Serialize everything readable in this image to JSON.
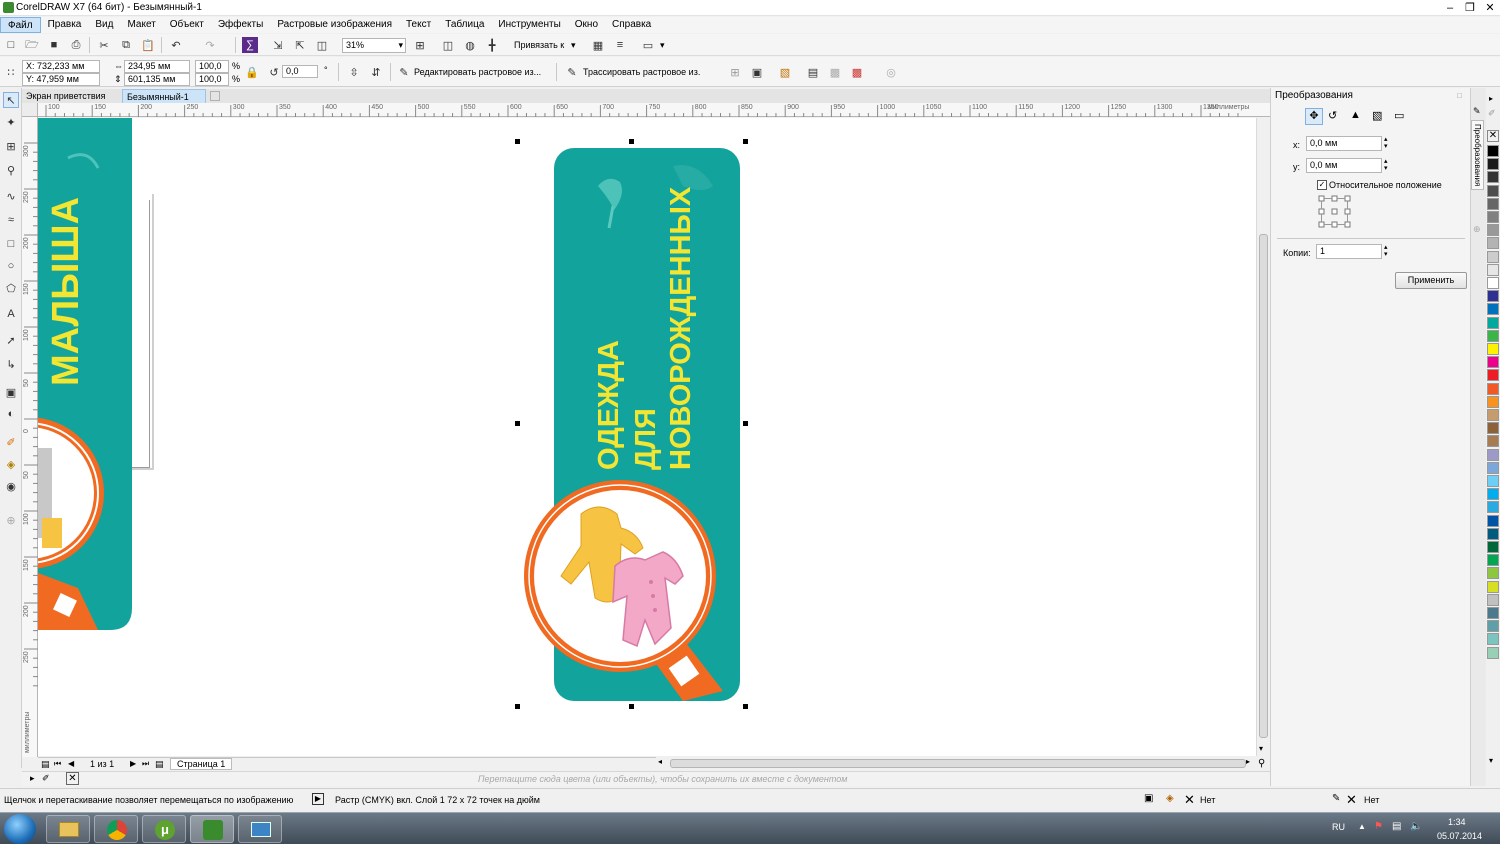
{
  "window": {
    "title": "CorelDRAW X7 (64 бит) - Безымянный-1"
  },
  "menu": [
    "Файл",
    "Правка",
    "Вид",
    "Макет",
    "Объект",
    "Эффекты",
    "Растровые изображения",
    "Текст",
    "Таблица",
    "Инструменты",
    "Окно",
    "Справка"
  ],
  "toolbar1": {
    "zoom": "31%",
    "snap_label": "Привязать к"
  },
  "propbar": {
    "x": "X: 732,233 мм",
    "y": "Y: 47,959 мм",
    "width": "234,95 мм",
    "height": "601,135 мм",
    "scale_w": "100,0",
    "scale_h": "100,0",
    "percent": "%",
    "angle": "0,0",
    "degree": "°",
    "edit_bitmap": "Редактировать растровое из...",
    "trace_bitmap": "Трассировать растровое из."
  },
  "doc_tabs": [
    "Экран приветствия",
    "Безымянный-1"
  ],
  "ruler_h": [
    "100",
    "150",
    "200",
    "250",
    "300",
    "350",
    "400",
    "450",
    "500",
    "550",
    "600",
    "650",
    "700",
    "750",
    "800",
    "850",
    "900",
    "950",
    "1000",
    "1050",
    "1100",
    "1150",
    "1200",
    "1250",
    "1300",
    "1350"
  ],
  "ruler_h_unit": "миллиметры",
  "ruler_v": [
    "300",
    "250",
    "200",
    "150",
    "100",
    "50",
    "0",
    "50",
    "100",
    "150",
    "200",
    "250"
  ],
  "ruler_v_unit": "миллиметры",
  "artwork": {
    "left_text": "МАЛЫША",
    "main_lines": [
      "ОДЕЖДА",
      "ДЛЯ",
      "НОВОРОЖДЕННЫХ"
    ],
    "teal": "#12a39c",
    "orange": "#f06a22",
    "text_color": "#f3e632"
  },
  "pagebar": {
    "counter": "1 из 1",
    "page_tab": "Страница 1"
  },
  "doc_palette_hint": "Перетащите сюда цвета (или объекты), чтобы сохранить их вместе с документом",
  "docker": {
    "title": "Преобразования",
    "tab_label": "Преобразования",
    "x_label": "x:",
    "x_value": "0,0 мм",
    "y_label": "y:",
    "y_value": "0,0 мм",
    "relative": "Относительное положение",
    "copies_label": "Копии:",
    "copies_value": "1",
    "apply": "Применить"
  },
  "status": {
    "hint": "Щелчок и перетаскивание позволяет перемещаться по изображению",
    "info": "Растр (CMYK) вкл. Слой 1 72 x 72 точек на дюйм",
    "fill_none": "Нет",
    "outline_none": "Нет"
  },
  "taskbar": {
    "lang": "RU",
    "time": "1:34",
    "date": "05.07.2014"
  },
  "palette_colors": [
    "#000000",
    "#1a1a1a",
    "#333333",
    "#4d4d4d",
    "#666666",
    "#808080",
    "#999999",
    "#b3b3b3",
    "#cccccc",
    "#e6e6e6",
    "#ffffff",
    "#2e3192",
    "#0071bc",
    "#00a99d",
    "#39b54a",
    "#fff200",
    "#ec008c",
    "#ed1c24",
    "#f15a24",
    "#f7931e",
    "#c69c6d",
    "#8c6239",
    "#a67c52",
    "#9e9ac8",
    "#7da7d9",
    "#6dcff6",
    "#00aeef",
    "#29abe2",
    "#0054a6",
    "#005b7f",
    "#006838",
    "#00a651",
    "#8dc63f",
    "#d7df23",
    "#c0c0c0",
    "#4c7a8c",
    "#5e9fa8",
    "#7bc4c0",
    "#97d0b4"
  ]
}
